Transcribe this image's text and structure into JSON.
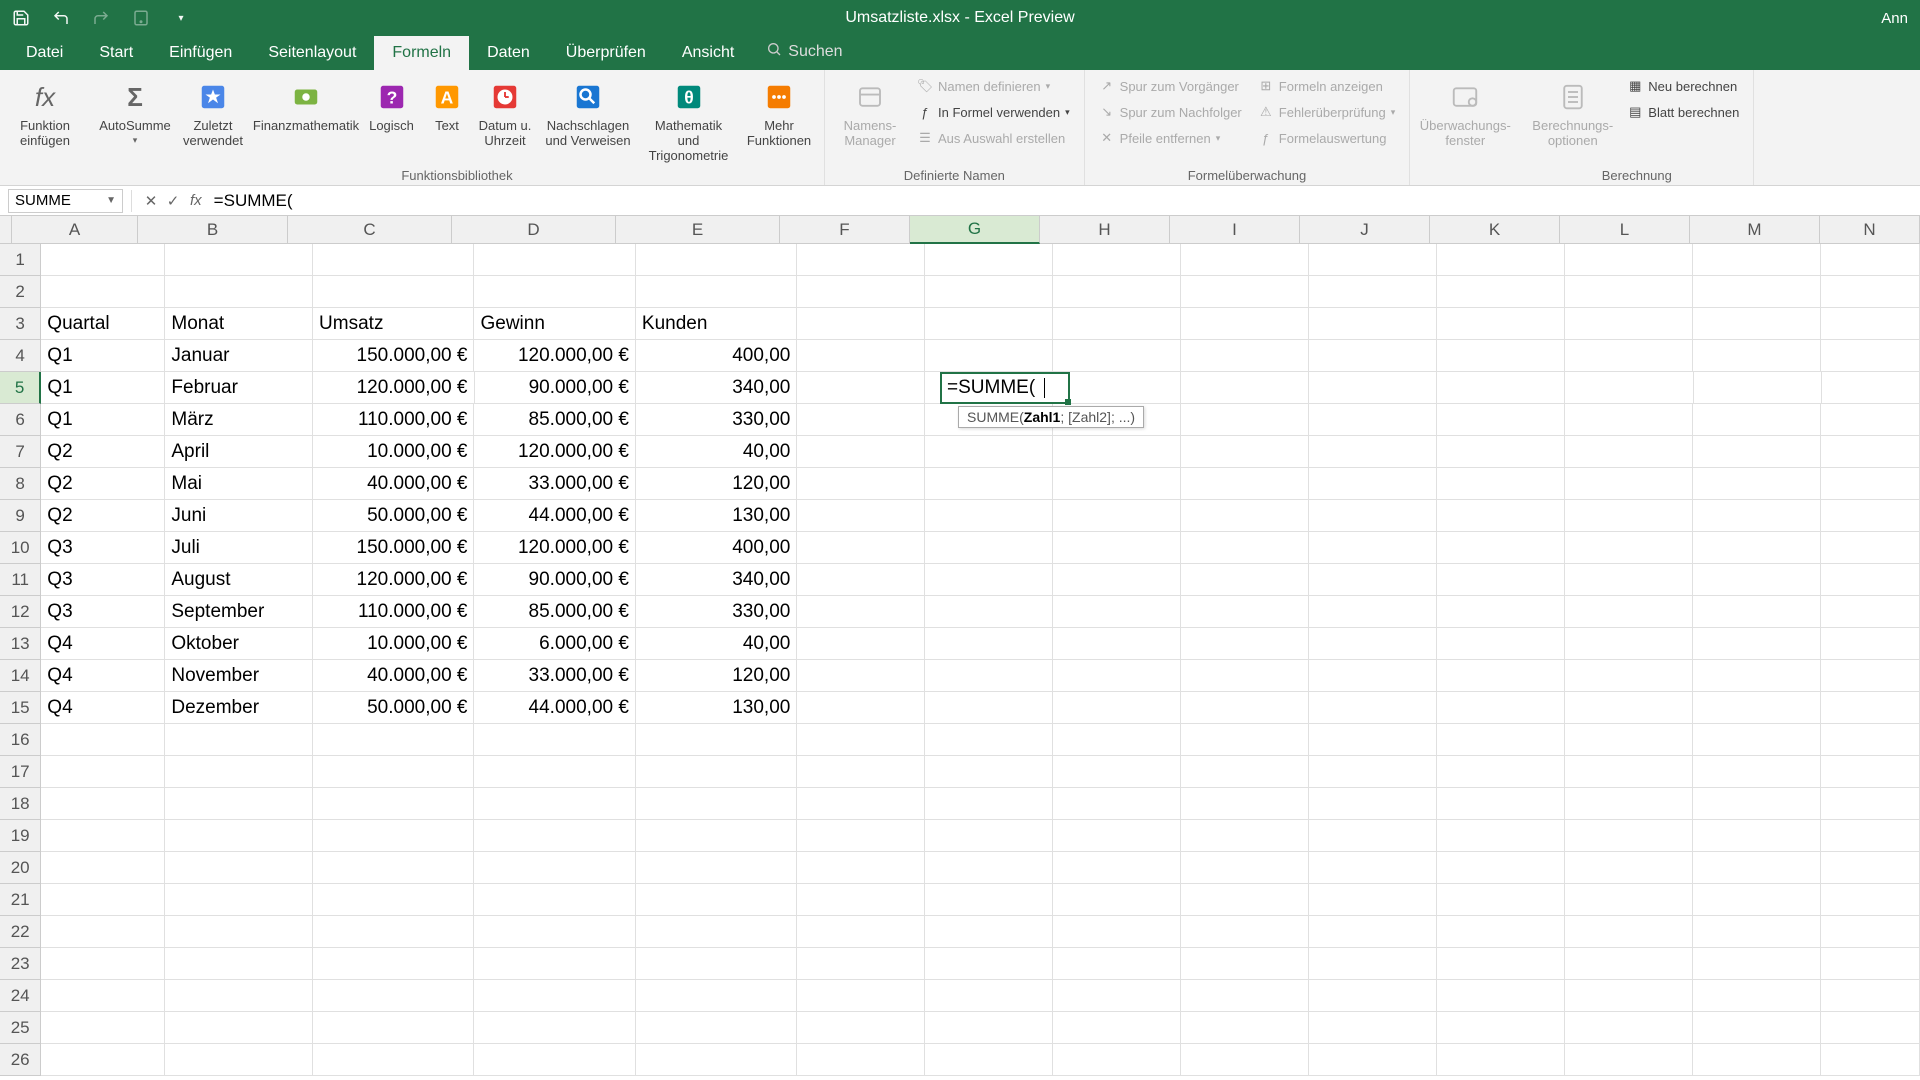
{
  "titlebar": {
    "title": "Umsatzliste.xlsx - Excel Preview",
    "user": "Ann"
  },
  "tabs": {
    "datei": "Datei",
    "start": "Start",
    "einfuegen": "Einfügen",
    "seitenlayout": "Seitenlayout",
    "formeln": "Formeln",
    "daten": "Daten",
    "ueberpruefen": "Überprüfen",
    "ansicht": "Ansicht",
    "search": "Suchen"
  },
  "ribbon": {
    "funktion_einf": "Funktion einfügen",
    "autosumme": "AutoSumme",
    "zuletzt": "Zuletzt verwendet",
    "finanz": "Finanzmathematik",
    "logisch": "Logisch",
    "text": "Text",
    "datum": "Datum u. Uhrzeit",
    "nachschlagen": "Nachschlagen und Verweisen",
    "mathe": "Mathematik und Trigonometrie",
    "mehr": "Mehr Funktionen",
    "funktionsbib": "Funktionsbibliothek",
    "namens_mgr": "Namens-Manager",
    "namen_def": "Namen definieren",
    "in_formel": "In Formel verwenden",
    "aus_auswahl": "Aus Auswahl erstellen",
    "def_namen": "Definierte Namen",
    "spur_vor": "Spur zum Vorgänger",
    "spur_nach": "Spur zum Nachfolger",
    "pfeile_ent": "Pfeile entfernen",
    "formeln_anz": "Formeln anzeigen",
    "fehler": "Fehlerüberprüfung",
    "formel_ausw": "Formelauswertung",
    "formel_ueber": "Formelüberwachung",
    "ueberw_fenster": "Überwachungs-fenster",
    "berech_opt": "Berechnungs-optionen",
    "neu_berech": "Neu berechnen",
    "blatt_berech": "Blatt berechnen",
    "berechnung": "Berechnung"
  },
  "namebox": "SUMME",
  "formula": "=SUMME(",
  "edit_value": "=SUMME(",
  "tooltip": {
    "fn": "SUMME(",
    "arg1": "Zahl1",
    "rest": "; [Zahl2]; ...)"
  },
  "headers": {
    "a": "Quartal",
    "b": "Monat",
    "c": "Umsatz",
    "d": "Gewinn",
    "e": "Kunden"
  },
  "data_rows": [
    {
      "q": "Q1",
      "m": "Januar",
      "u": "150.000,00 €",
      "g": "120.000,00 €",
      "k": "400,00"
    },
    {
      "q": "Q1",
      "m": "Februar",
      "u": "120.000,00 €",
      "g": "90.000,00 €",
      "k": "340,00"
    },
    {
      "q": "Q1",
      "m": "März",
      "u": "110.000,00 €",
      "g": "85.000,00 €",
      "k": "330,00"
    },
    {
      "q": "Q2",
      "m": "April",
      "u": "10.000,00 €",
      "g": "120.000,00 €",
      "k": "40,00"
    },
    {
      "q": "Q2",
      "m": "Mai",
      "u": "40.000,00 €",
      "g": "33.000,00 €",
      "k": "120,00"
    },
    {
      "q": "Q2",
      "m": "Juni",
      "u": "50.000,00 €",
      "g": "44.000,00 €",
      "k": "130,00"
    },
    {
      "q": "Q3",
      "m": "Juli",
      "u": "150.000,00 €",
      "g": "120.000,00 €",
      "k": "400,00"
    },
    {
      "q": "Q3",
      "m": "August",
      "u": "120.000,00 €",
      "g": "90.000,00 €",
      "k": "340,00"
    },
    {
      "q": "Q3",
      "m": "September",
      "u": "110.000,00 €",
      "g": "85.000,00 €",
      "k": "330,00"
    },
    {
      "q": "Q4",
      "m": "Oktober",
      "u": "10.000,00 €",
      "g": "6.000,00 €",
      "k": "40,00"
    },
    {
      "q": "Q4",
      "m": "November",
      "u": "40.000,00 €",
      "g": "33.000,00 €",
      "k": "120,00"
    },
    {
      "q": "Q4",
      "m": "Dezember",
      "u": "50.000,00 €",
      "g": "44.000,00 €",
      "k": "130,00"
    }
  ],
  "columns": [
    "A",
    "B",
    "C",
    "D",
    "E",
    "F",
    "G",
    "H",
    "I",
    "J",
    "K",
    "L",
    "M",
    "N"
  ]
}
